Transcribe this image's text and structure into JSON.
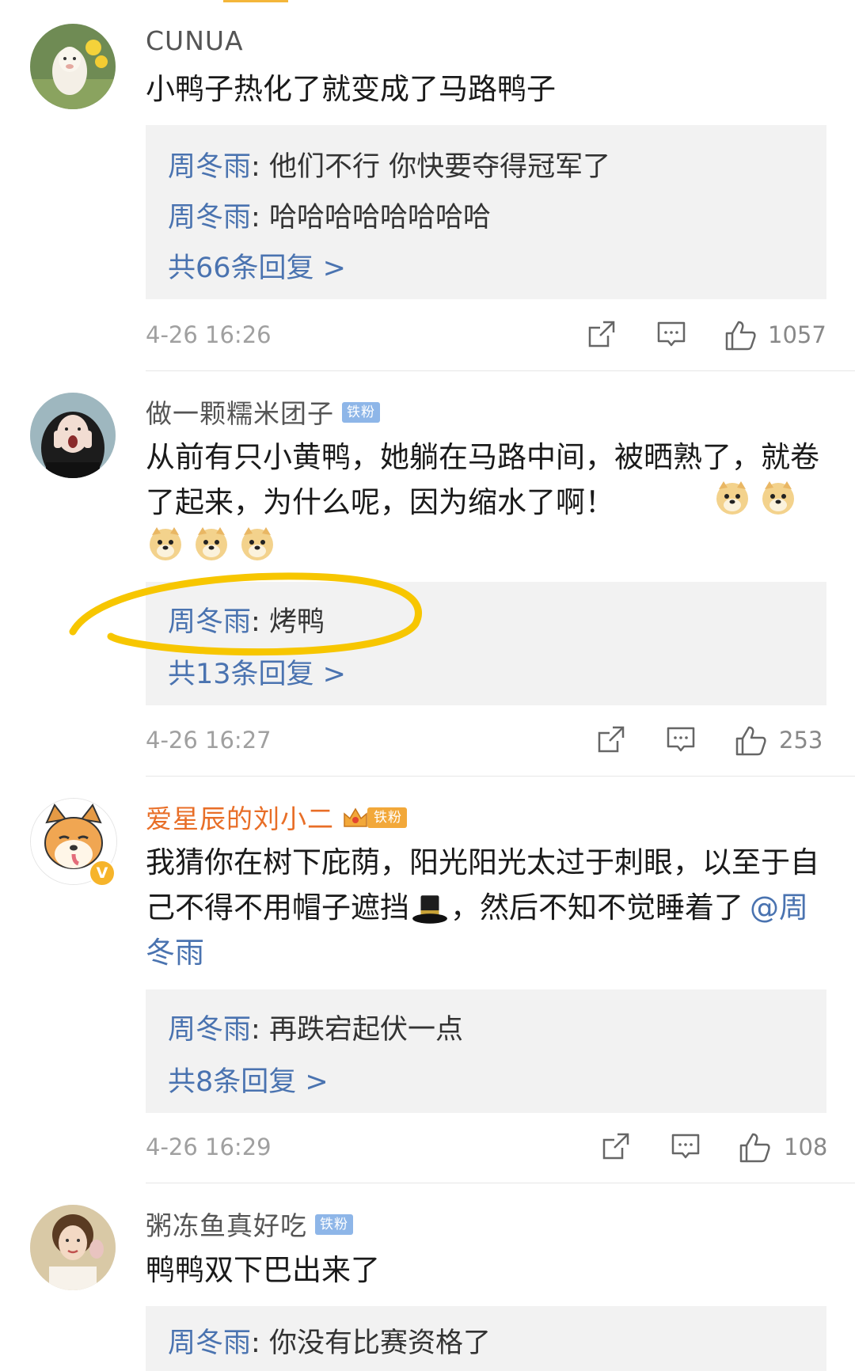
{
  "comments": [
    {
      "username": "CUNUA",
      "text": "小鸭子热化了就变成了马路鸭子",
      "replies": [
        {
          "author": "周冬雨",
          "sep": ": ",
          "text": "他们不行  你快要夺得冠军了"
        },
        {
          "author": "周冬雨",
          "sep": ": ",
          "text": "哈哈哈哈哈哈哈哈"
        }
      ],
      "reply_count": "共66条回复 >",
      "timestamp": "4-26 16:26",
      "likes": "1057"
    },
    {
      "username": "做一颗糯米团子",
      "badge": "铁粉",
      "text": "从前有只小黄鸭，她躺在马路中间，被晒熟了，就卷了起来，为什么呢，因为缩水了啊！",
      "emoji": "doge",
      "replies": [
        {
          "author": "周冬雨",
          "sep": ": ",
          "text": "烤鸭"
        }
      ],
      "reply_count": "共13条回复 >",
      "timestamp": "4-26 16:27",
      "likes": "253"
    },
    {
      "username": "爱星辰的刘小二",
      "badge": "铁粉",
      "verified": "V",
      "text": "我猜你在树下庇荫，阳光阳光太过于刺眼，以至于自己不得不用帽子遮挡",
      "text_after_emoji": "，然后不知不觉睡着了",
      "mention": "@周冬雨",
      "replies": [
        {
          "author": "周冬雨",
          "sep": ": ",
          "text": "再跌宕起伏一点"
        }
      ],
      "reply_count": "共8条回复 >",
      "timestamp": "4-26 16:29",
      "likes": "108"
    },
    {
      "username": "粥冻鱼真好吃",
      "badge": "铁粉",
      "text": "鸭鸭双下巴出来了",
      "replies": [
        {
          "author": "周冬雨",
          "sep": ": ",
          "text": "你没有比赛资格了"
        }
      ]
    }
  ],
  "icons": {
    "share": "share-icon",
    "comment": "comment-icon",
    "like": "thumbs-up-icon",
    "emoji_doge": "doge-emoji-icon",
    "emoji_hat": "top-hat-emoji-icon"
  },
  "colors": {
    "link_blue": "#4a73b0",
    "username_orange": "#e86e27",
    "reply_bg": "#f2f2f2",
    "highlight_yellow": "#f7c600"
  }
}
